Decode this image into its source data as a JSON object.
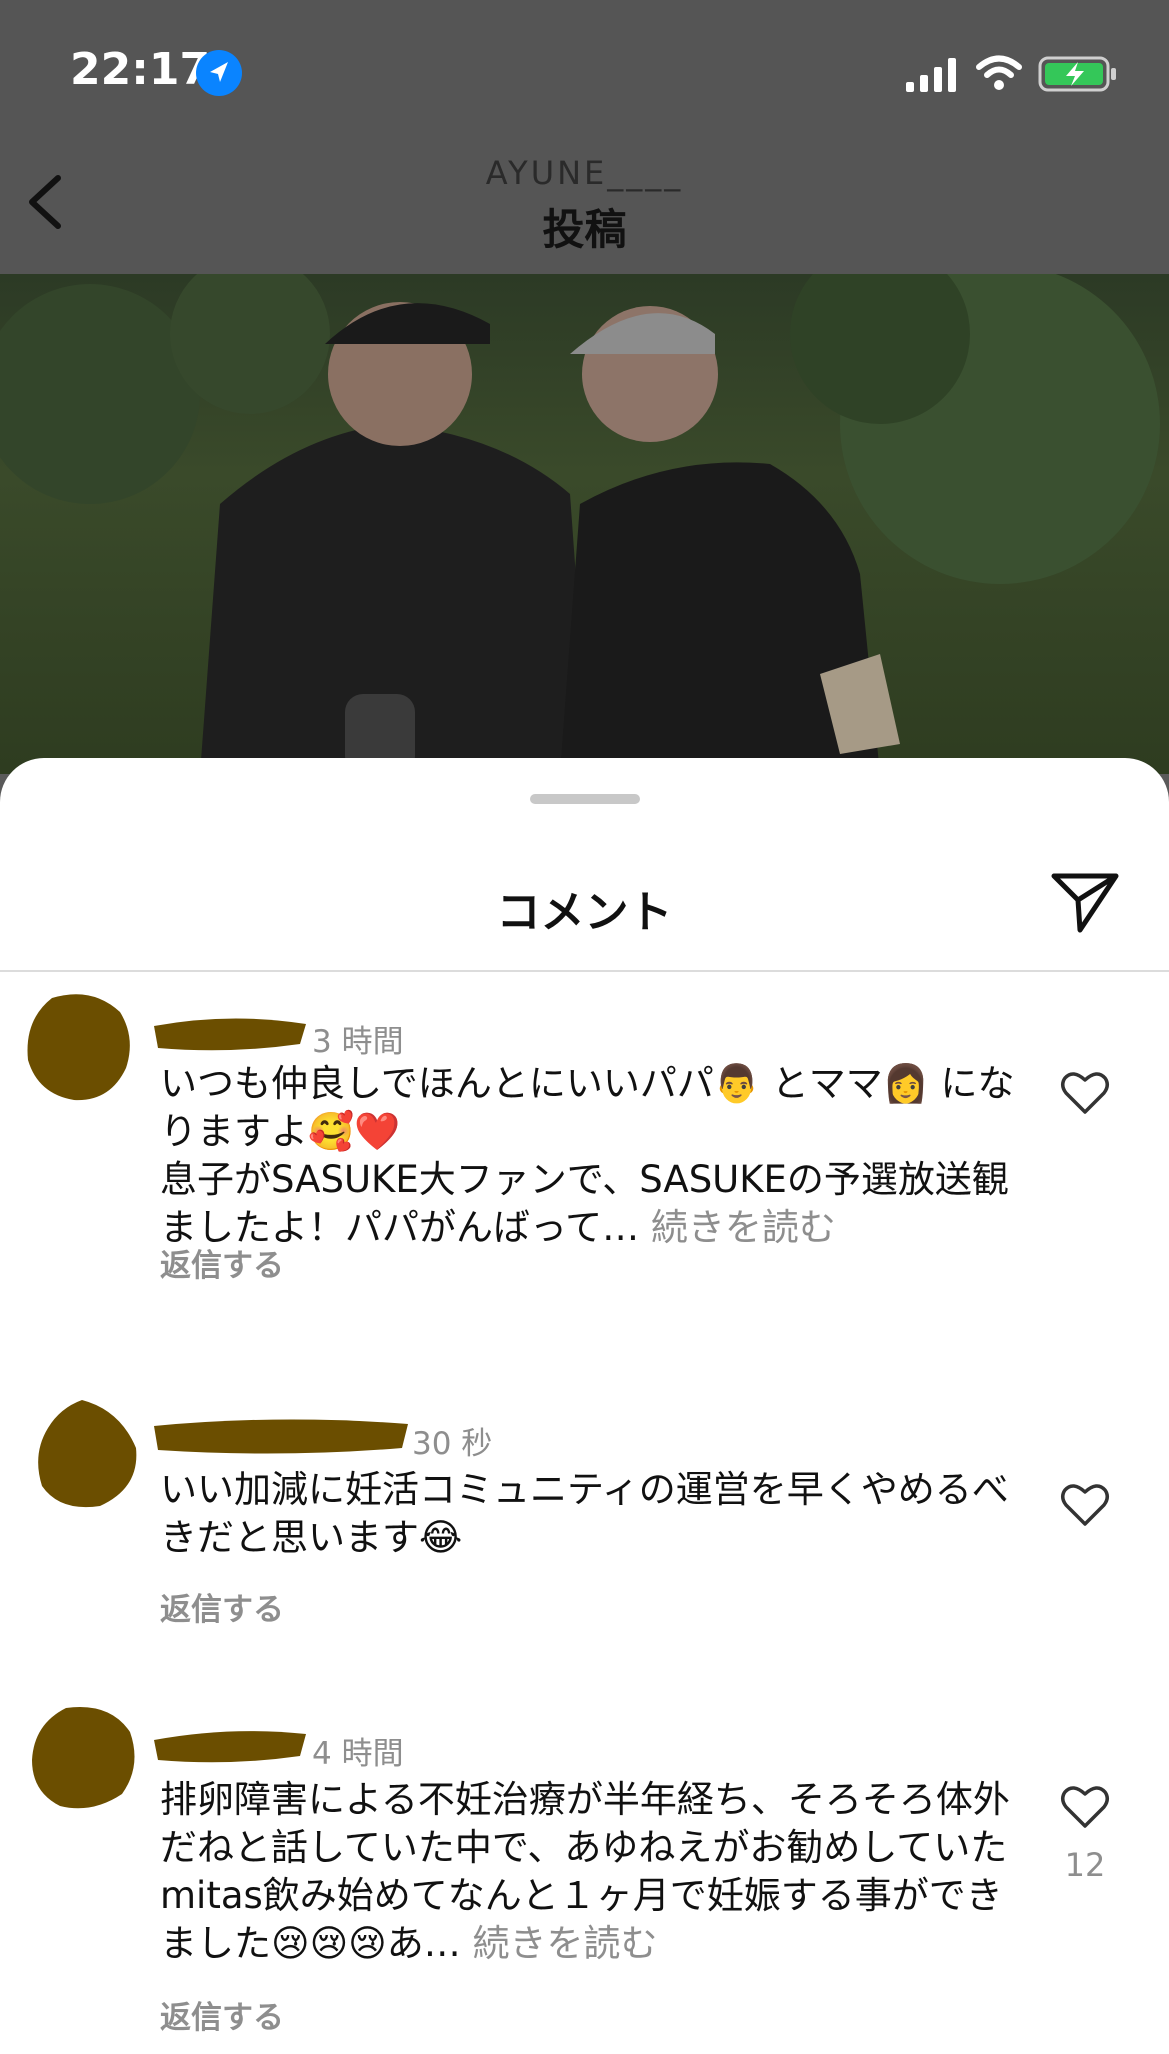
{
  "status_bar": {
    "time": "22:17",
    "icons": [
      "location-arrow-icon",
      "cellular-signal-icon",
      "wifi-icon",
      "battery-charging-icon"
    ],
    "battery_color": "#34c759"
  },
  "header": {
    "account_name": "AYUNE____",
    "title": "投稿",
    "back_icon": "chevron-left-icon"
  },
  "sheet": {
    "title": "コメント",
    "share_icon": "paper-plane-icon"
  },
  "comments": [
    {
      "time": "3 時間",
      "text": "いつも仲良しでほんとにいいパパ👨 とママ👩 になりますよ🥰❤️",
      "text2": "息子がSASUKE大ファンで、SASUKEの予選放送観ましたよ！パパがんばって…",
      "more": "続きを読む",
      "reply": "返信する"
    },
    {
      "time": "30 秒",
      "text": "いい加減に妊活コミュニティの運営を早くやめるべきだと思います😂",
      "reply": "返信する"
    },
    {
      "time": "4 時間",
      "text": "排卵障害による不妊治療が半年経ち、そろそろ体外だねと話していた中で、あゆねえがお勧めしていたmitas飲み始めてなんと１ヶ月で妊娠する事ができました😢😢😢あ…",
      "more": "続きを読む",
      "reply": "返信する",
      "likes": "12"
    }
  ],
  "colors": {
    "scribble": "#6b4e00",
    "secondary_text": "#8e8e8e",
    "accent_blue": "#0a84ff"
  }
}
